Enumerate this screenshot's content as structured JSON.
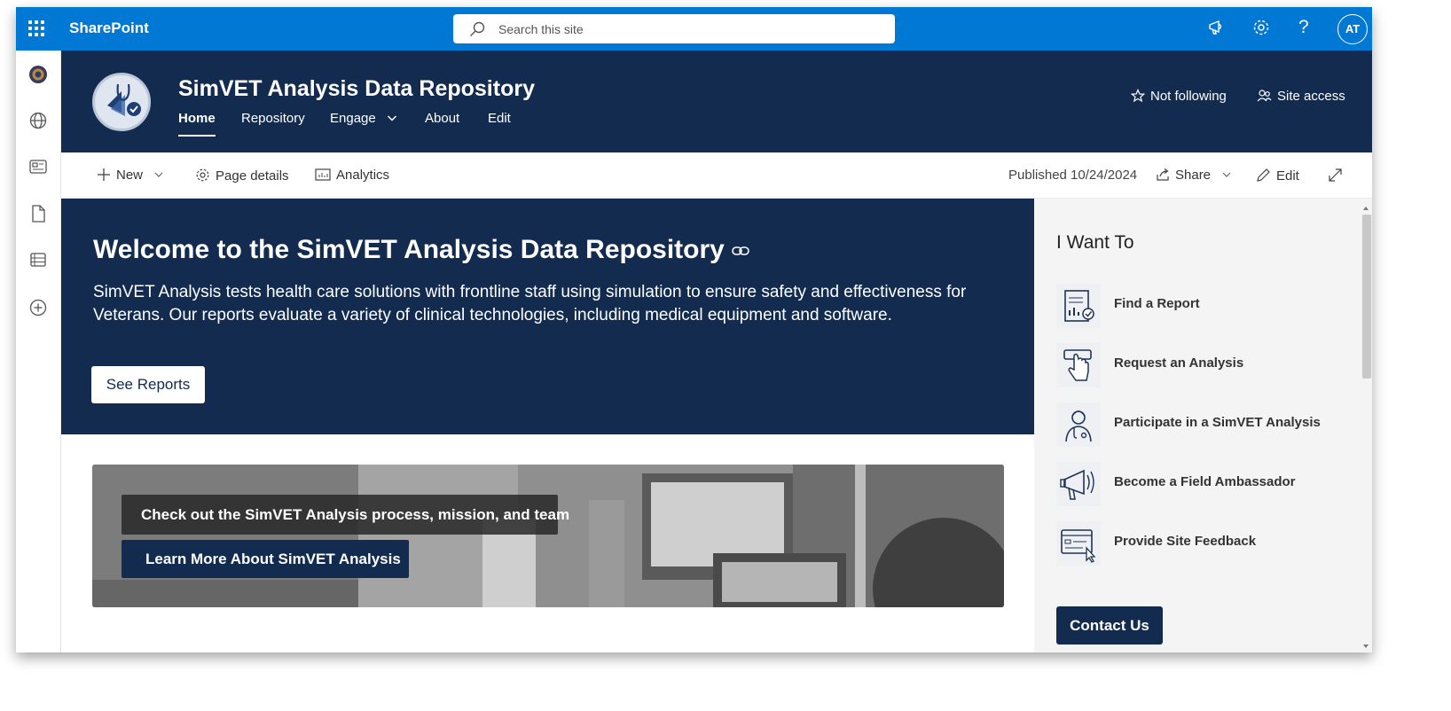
{
  "suite": {
    "brand": "SharePoint",
    "search_placeholder": "Search this site",
    "avatar_initials": "AT",
    "accent": "#0078d4"
  },
  "site": {
    "title": "SimVET Analysis Data Repository",
    "nav": [
      "Home",
      "Repository",
      "Engage",
      "About",
      "Edit"
    ],
    "follow_label": "Not following",
    "access_label": "Site access",
    "header_color": "#122b4f"
  },
  "commandbar": {
    "new_label": "New",
    "page_details_label": "Page details",
    "analytics_label": "Analytics",
    "published": "Published 10/24/2024",
    "share_label": "Share",
    "edit_label": "Edit"
  },
  "hero": {
    "title": "Welcome to the SimVET Analysis Data Repository",
    "description": "SimVET Analysis tests health care solutions with frontline staff using simulation to ensure safety and effectiveness for Veterans. Our reports evaluate a variety of clinical technologies, including medical equipment and software.",
    "button": "See Reports"
  },
  "banner": {
    "caption": "Check out the SimVET Analysis process, mission, and team",
    "button": "Learn More About SimVET Analysis"
  },
  "panel": {
    "heading": "I Want To",
    "links": [
      {
        "label": "Find a Report",
        "icon": "report-icon"
      },
      {
        "label": "Request an Analysis",
        "icon": "pointing-hand-icon"
      },
      {
        "label": "Participate in a SimVET Analysis",
        "icon": "clinician-icon"
      },
      {
        "label": "Become a Field Ambassador",
        "icon": "megaphone-icon"
      },
      {
        "label": "Provide Site Feedback",
        "icon": "feedback-form-icon"
      }
    ],
    "contact": "Contact Us"
  }
}
